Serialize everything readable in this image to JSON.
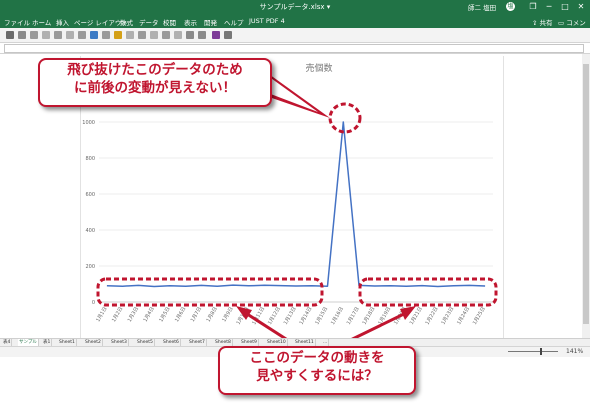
{
  "window": {
    "title": "サンプルデータ.xlsx ▾",
    "user": "師二 塩田",
    "avatar_letter": "塩",
    "controls": [
      "❐",
      "─",
      "□",
      "✕"
    ]
  },
  "ribbon": {
    "tabs": [
      "ファイル",
      "ホーム",
      "挿入",
      "ページ レイアウト",
      "数式",
      "データ",
      "校閲",
      "表示",
      "開発",
      "ヘルプ",
      "JUST PDF 4"
    ],
    "share": "共有",
    "comment": "コメント"
  },
  "chart": {
    "title": "売個数",
    "accent": "#4472c4"
  },
  "chart_data": {
    "type": "line",
    "title": "売個数",
    "x": [
      "1月1日",
      "1月2日",
      "1月3日",
      "1月4日",
      "1月5日",
      "1月6日",
      "1月7日",
      "1月8日",
      "1月9日",
      "1月10日",
      "1月11日",
      "1月12日",
      "1月13日",
      "1月14日",
      "1月15日",
      "1月16日",
      "1月17日",
      "1月18日",
      "1月19日",
      "1月20日",
      "1月21日",
      "1月22日",
      "1月23日",
      "1月24日",
      "1月25日"
    ],
    "series": [
      {
        "values": [
          90,
          88,
          92,
          86,
          90,
          88,
          92,
          87,
          94,
          90,
          93,
          91,
          89,
          90,
          88,
          1000,
          92,
          89,
          90,
          87,
          91,
          86,
          90,
          92,
          89
        ],
        "color": "#4472c4"
      }
    ],
    "ylim": [
      0,
      1000
    ],
    "yticks": [
      0,
      200,
      400,
      600,
      800,
      1000
    ],
    "grid": true
  },
  "sheet_tabs": [
    "表4",
    "サンプル",
    "表1",
    "Sheet1",
    "Sheet2",
    "Sheet3",
    "Sheet5",
    "Sheet6",
    "Sheet7",
    "Sheet8",
    "Sheet9",
    "Sheet10",
    "Sheet11",
    "..."
  ],
  "active_tab": "サンプル",
  "status": {
    "zoom": "141%"
  },
  "callouts": {
    "top": [
      "飛び抜けたこのデータのため",
      "に前後の変動が見えない！"
    ],
    "bottom": [
      "ここのデータの動きを",
      "見やすくするには？"
    ],
    "color": "#c0152f"
  }
}
